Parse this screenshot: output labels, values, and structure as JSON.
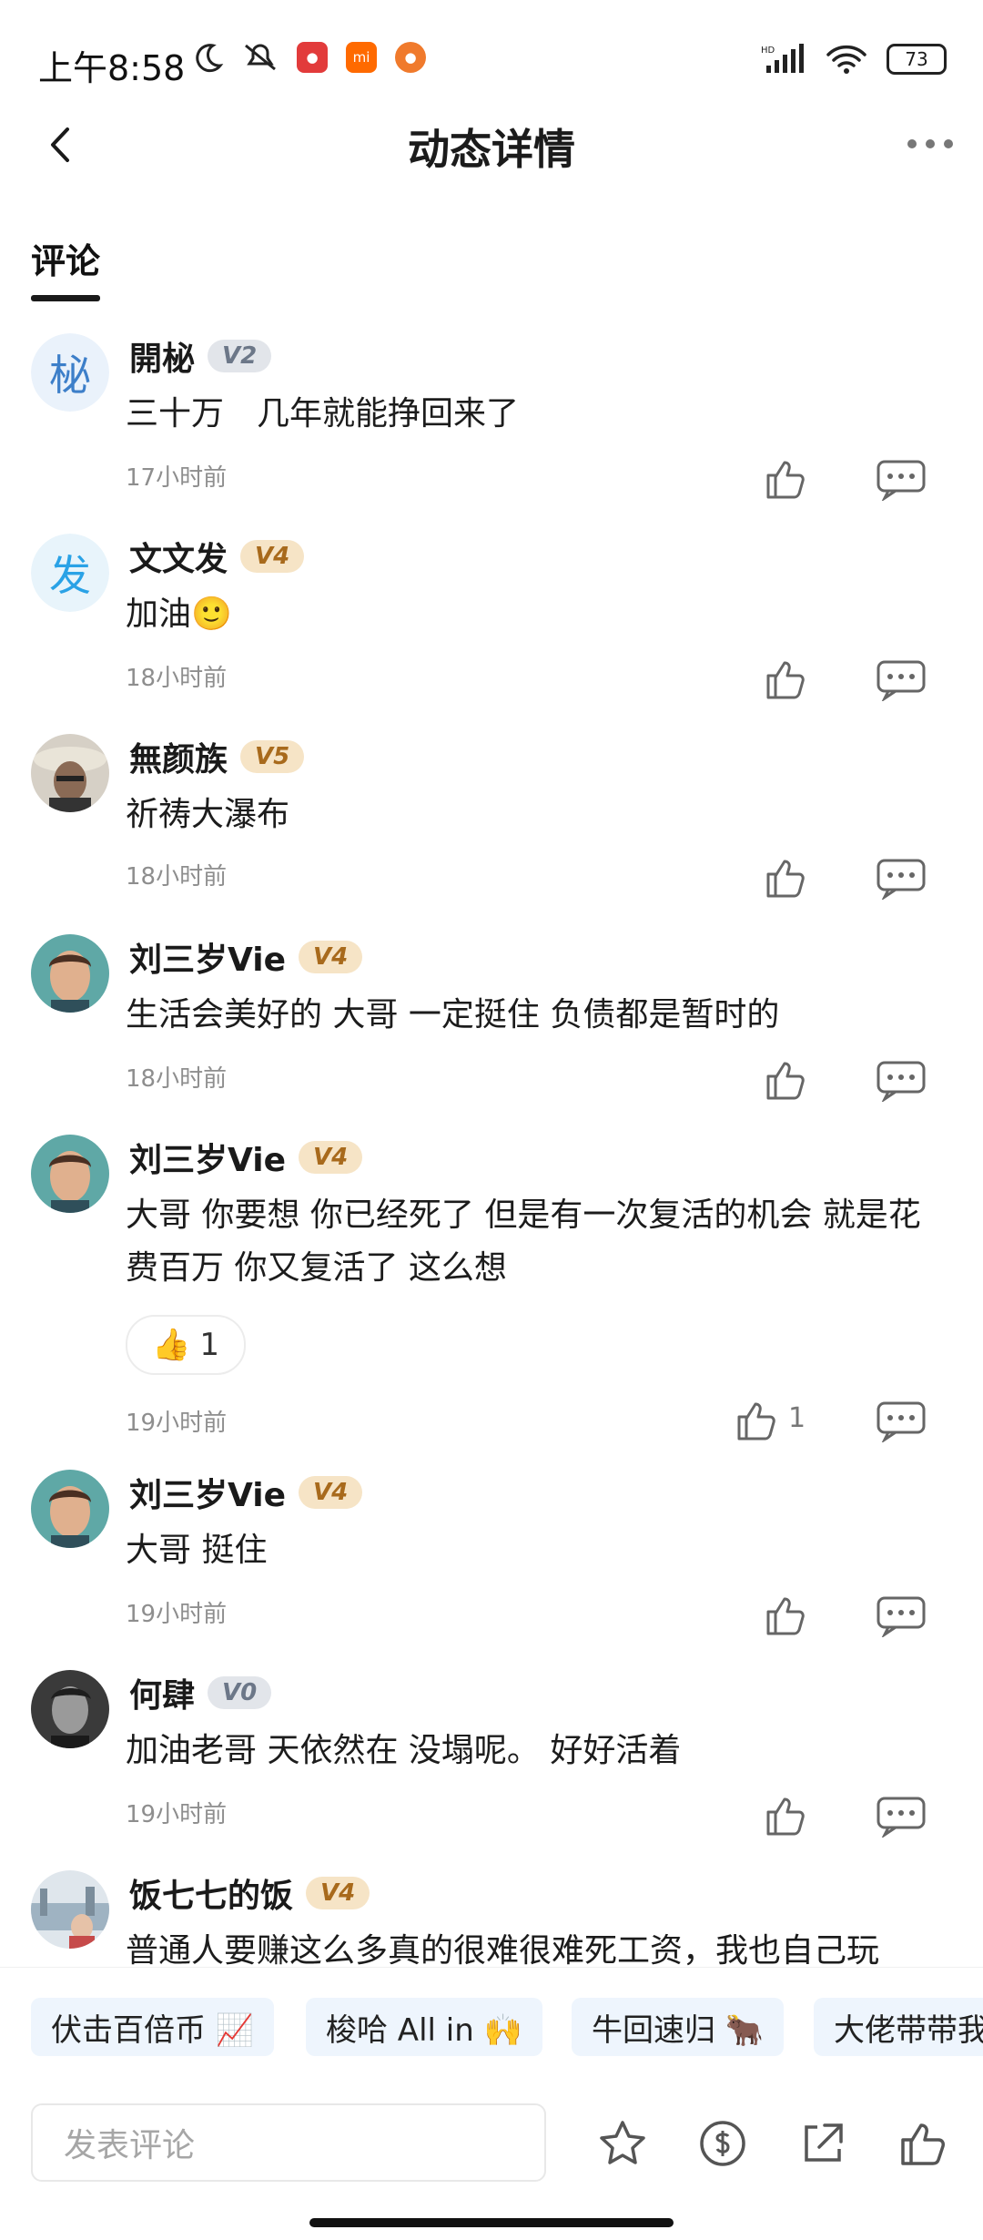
{
  "status": {
    "time": "上午8:58",
    "battery": "73",
    "net": "HD"
  },
  "nav": {
    "title": "动态详情"
  },
  "tab": {
    "label": "评论"
  },
  "comments": [
    {
      "name": "開柲",
      "level": "V2",
      "avatar_char": "柲",
      "text": "三十万　几年就能挣回来了",
      "time": "17小时前",
      "likes": ""
    },
    {
      "name": "文文发",
      "level": "V4",
      "avatar_char": "发",
      "text": "加油🙂",
      "time": "18小时前",
      "likes": ""
    },
    {
      "name": "無颜族",
      "level": "V5",
      "avatar_char": "",
      "text": "祈祷大瀑布",
      "time": "18小时前",
      "likes": ""
    },
    {
      "name": "刘三岁Vie",
      "level": "V4",
      "avatar_char": "",
      "text": "生活会美好的 大哥 一定挺住 负债都是暂时的",
      "time": "18小时前",
      "likes": ""
    },
    {
      "name": "刘三岁Vie",
      "level": "V4",
      "avatar_char": "",
      "text": "大哥 你要想 你已经死了 但是有一次复活的机会 就是花费百万 你又复活了 这么想",
      "time": "19小时前",
      "likes": "1",
      "reaction_emoji": "👍",
      "reaction_count": "1"
    },
    {
      "name": "刘三岁Vie",
      "level": "V4",
      "avatar_char": "",
      "text": "大哥 挺住",
      "time": "19小时前",
      "likes": ""
    },
    {
      "name": "何肆",
      "level": "V0",
      "avatar_char": "",
      "text": "加油老哥 天依然在 没塌呢。 好好活着",
      "time": "19小时前",
      "likes": ""
    },
    {
      "name": "饭七七的饭",
      "level": "V4",
      "avatar_char": "",
      "text": "普通人要赚这么多真的很难很难死工资，我也自己玩",
      "time": "",
      "likes": ""
    }
  ],
  "chips": [
    "伏击百倍币 📈",
    "梭哈 All in 🙌",
    "牛回速归 🐂",
    "大佬带带我"
  ],
  "bottom": {
    "input_placeholder": "发表评论"
  },
  "colors": {
    "badge_gold_bg": "#f6e4c6",
    "badge_gold_fg": "#a86a1c",
    "badge_gray_bg": "#e2e5ea",
    "badge_gray_fg": "#6c7788",
    "chip_bg": "#eef5fd"
  }
}
